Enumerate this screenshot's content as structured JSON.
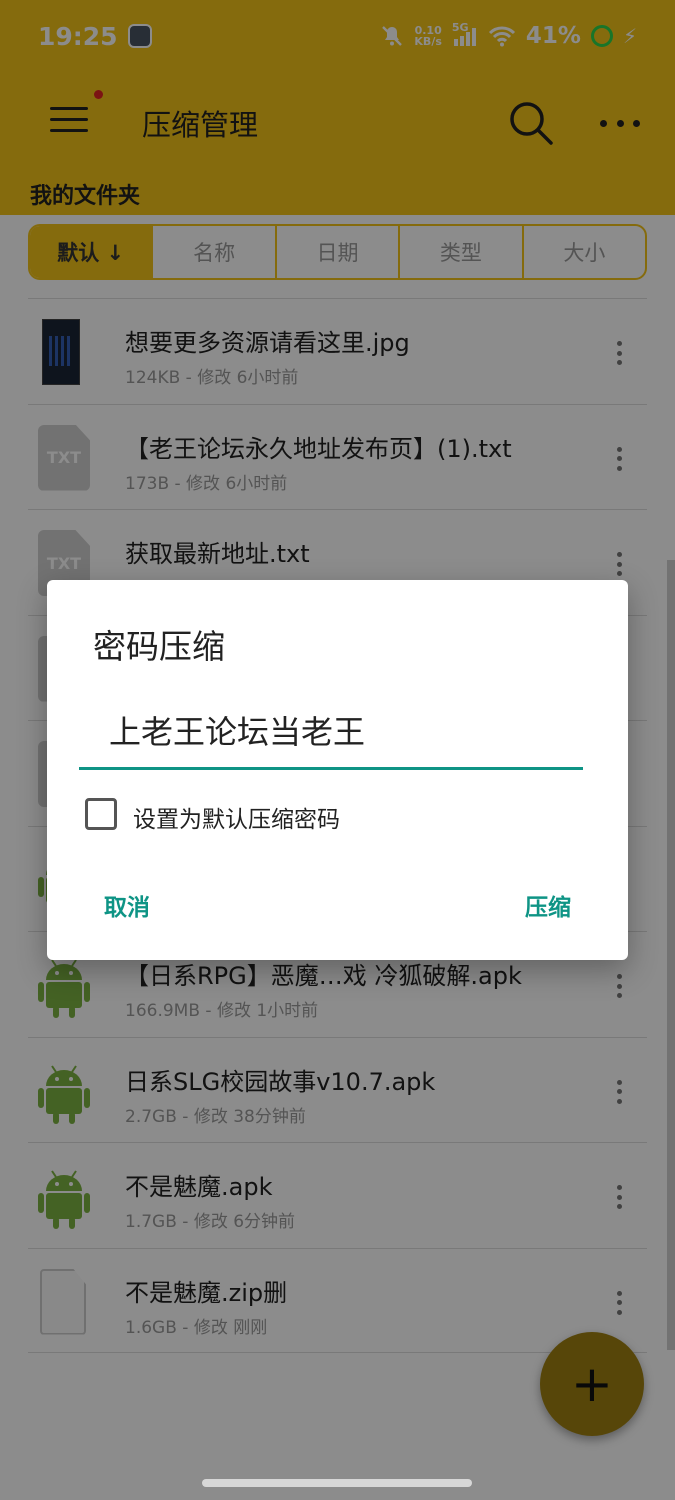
{
  "status_bar": {
    "time": "19:25",
    "net_speed_top": "0.10",
    "net_speed_bottom": "KB/s",
    "network": "5G",
    "battery": "41%"
  },
  "toolbar": {
    "title": "压缩管理",
    "menu_icon": "hamburger-menu-icon",
    "search_icon": "search-icon",
    "more_icon": "more-horizontal-icon"
  },
  "folder_label": "我的文件夹",
  "sort_tabs": [
    "默认 ↓",
    "名称",
    "日期",
    "类型",
    "大小"
  ],
  "files": [
    {
      "name": "想要更多资源请看这里.jpg",
      "meta": "124KB - 修改 6小时前",
      "icon": "image-thumbnail"
    },
    {
      "name": "【老王论坛永久地址发布页】(1).txt",
      "meta": "173B - 修改 6小时前",
      "icon": "txt-file-icon"
    },
    {
      "name": "获取最新地址.txt",
      "meta": "",
      "icon": "txt-file-icon"
    },
    {
      "name": "",
      "meta": "",
      "icon": "txt-file-icon"
    },
    {
      "name": "",
      "meta": "",
      "icon": "txt-file-icon"
    },
    {
      "name": "",
      "meta": "",
      "icon": "android-apk-icon"
    },
    {
      "name": "【日系RPG】恶魔…戏 冷狐破解.apk",
      "meta": "166.9MB - 修改 1小时前",
      "icon": "android-apk-icon"
    },
    {
      "name": "日系SLG校园故事v10.7.apk",
      "meta": "2.7GB - 修改 38分钟前",
      "icon": "android-apk-icon"
    },
    {
      "name": "不是魅魔.apk",
      "meta": "1.7GB - 修改 6分钟前",
      "icon": "android-apk-icon"
    },
    {
      "name": "不是魅魔.zip删",
      "meta": "1.6GB - 修改 刚刚",
      "icon": "blank-file-icon"
    }
  ],
  "txt_badge": "TXT",
  "dialog": {
    "title": "密码压缩",
    "password_value": "上老王论坛当老王",
    "checkbox_label": "设置为默认压缩密码",
    "checkbox_checked": false,
    "cancel_label": "取消",
    "confirm_label": "压缩"
  },
  "fab": {
    "label": "+"
  },
  "colors": {
    "app_bar": "#f2c318",
    "accent": "#0e9485",
    "android_green": "#7cb342"
  }
}
